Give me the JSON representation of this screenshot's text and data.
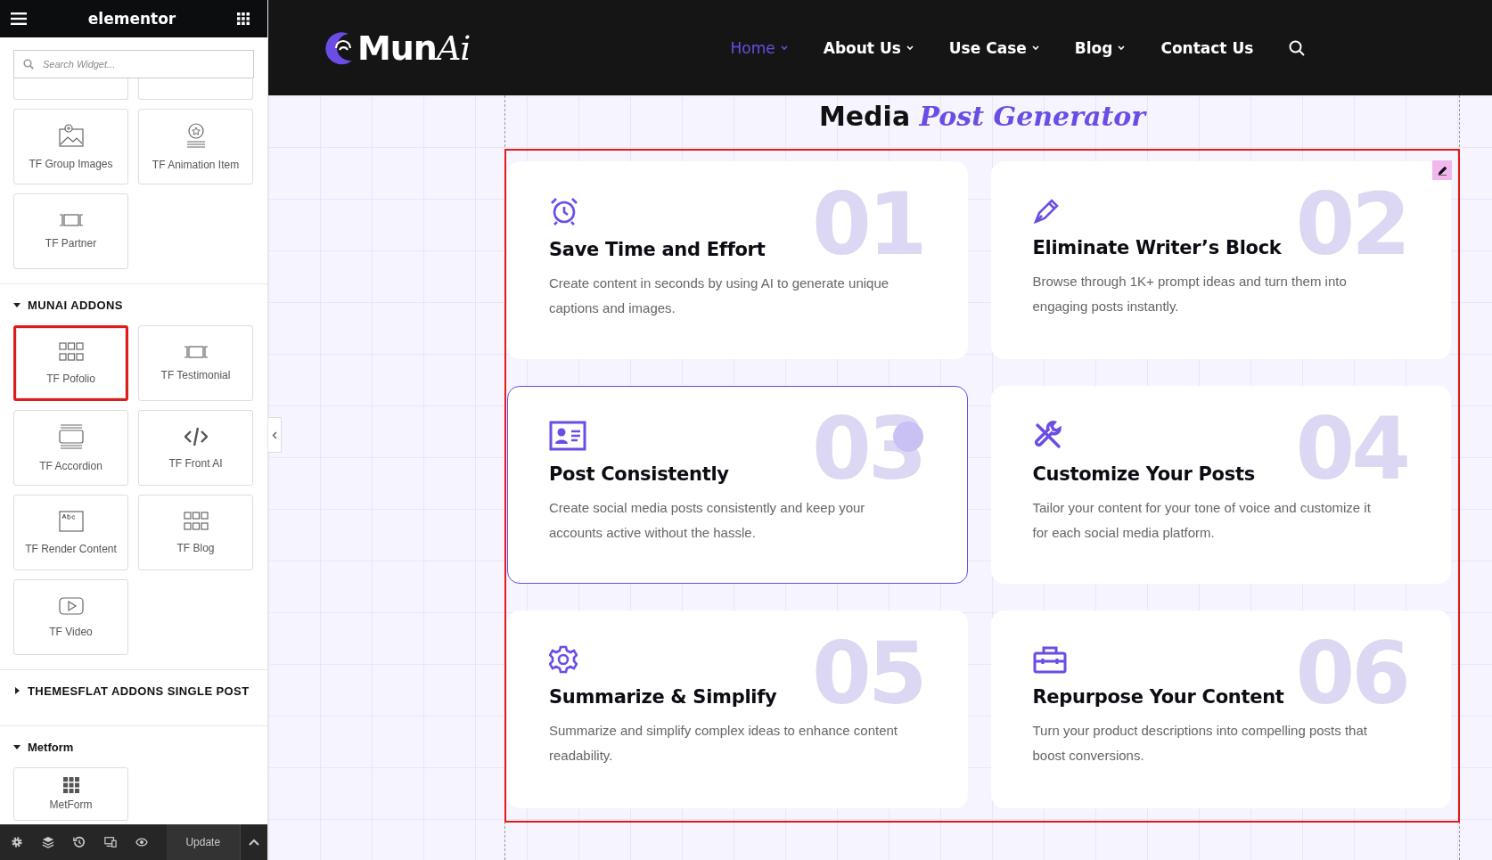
{
  "editor": {
    "brand": "elementor",
    "search": {
      "placeholder": "Search Widget..."
    },
    "top_widgets": [
      {
        "label": "TF Group Images",
        "selected": false
      },
      {
        "label": "TF Animation Item",
        "selected": false
      },
      {
        "label": "TF Partner",
        "selected": false
      }
    ],
    "sections": [
      {
        "title": "MUNAI ADDONS",
        "expanded": true,
        "widgets": [
          {
            "label": "TF Pofolio",
            "selected": true
          },
          {
            "label": "TF Testimonial",
            "selected": false
          },
          {
            "label": "TF Accordion",
            "selected": false
          },
          {
            "label": "TF Front AI",
            "selected": false
          },
          {
            "label": "TF Render Content",
            "selected": false
          },
          {
            "label": "TF Blog",
            "selected": false
          },
          {
            "label": "TF Video",
            "selected": false
          }
        ]
      },
      {
        "title": "THEMESFLAT ADDONS SINGLE POST",
        "expanded": false
      },
      {
        "title": "Metform",
        "expanded": true,
        "widgets": [
          {
            "label": "MetForm",
            "selected": false
          }
        ]
      }
    ],
    "update_button": "Update"
  },
  "site": {
    "logo": {
      "text": "Mun",
      "accent": "Ai"
    },
    "nav": [
      {
        "label": "Home",
        "selected": true,
        "dropdown": true
      },
      {
        "label": "About Us",
        "selected": false,
        "dropdown": true
      },
      {
        "label": "Use Case",
        "selected": false,
        "dropdown": true
      },
      {
        "label": "Blog",
        "selected": false,
        "dropdown": true
      },
      {
        "label": "Contact Us",
        "selected": false,
        "dropdown": false
      }
    ],
    "heading": {
      "text": "Media",
      "accent": "Post Generator"
    },
    "features": [
      {
        "number": "01",
        "title": "Save Time and Effort",
        "text": "Create content in seconds by using AI to generate unique captions and images.",
        "selected": false
      },
      {
        "number": "02",
        "title": "Eliminate Writer’s Block",
        "text": "Browse through 1K+ prompt ideas and turn them into engaging posts instantly.",
        "selected": false
      },
      {
        "number": "03",
        "title": "Post Consistently",
        "text": "Create social media posts consistently and keep your accounts active without the hassle.",
        "selected": true
      },
      {
        "number": "04",
        "title": "Customize Your Posts",
        "text": "Tailor your content for your tone of voice and customize it for each social media platform.",
        "selected": false
      },
      {
        "number": "05",
        "title": "Summarize & Simplify",
        "text": "Summarize and simplify complex ideas to enhance content readability.",
        "selected": false
      },
      {
        "number": "06",
        "title": "Repurpose Your Content",
        "text": "Turn your product descriptions into compelling posts that boost conversions.",
        "selected": false
      }
    ]
  }
}
